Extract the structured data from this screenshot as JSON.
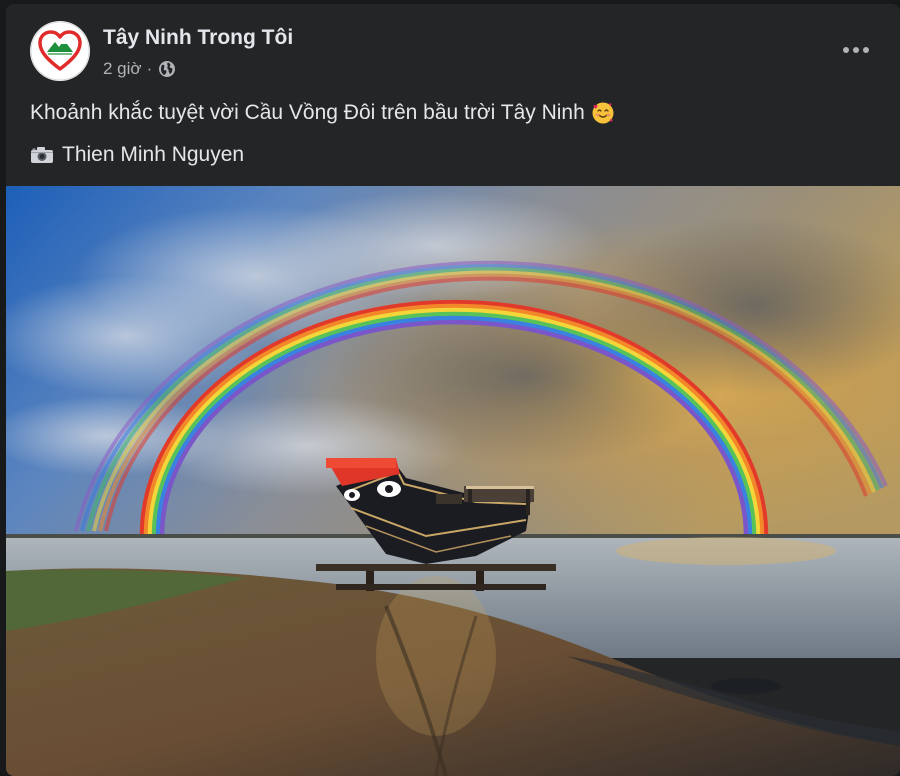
{
  "post": {
    "page_name": "Tây Ninh Trong Tôi",
    "timestamp": "2 giờ",
    "separator": "·",
    "audience_icon": "globe-icon",
    "more_icon": "more-options-icon",
    "caption_text": "Khoảnh khắc tuyệt vời Cầu Vồng Đôi trên bầu trời Tây Ninh",
    "caption_emoji": "smiling-face-with-hearts-icon",
    "credit_icon": "camera-icon",
    "credit_text": "Thien Minh Nguyen"
  },
  "photo": {
    "subject": "double-rainbow-over-boat-on-lakeshore"
  },
  "colors": {
    "post_background": "#242526",
    "page_background": "#18191a",
    "primary_text": "#e4e6eb",
    "secondary_text": "#b0b3b8",
    "avatar_heart": "#e02b2b",
    "avatar_mountain": "#1e8f3a"
  }
}
